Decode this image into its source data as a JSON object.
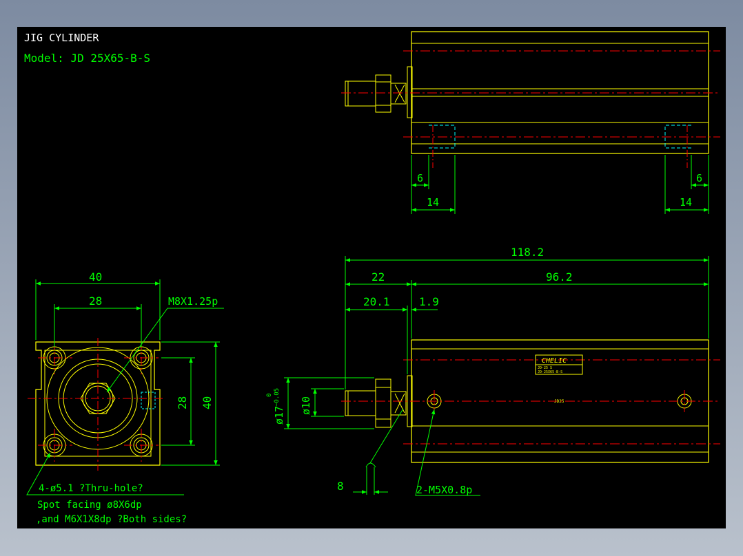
{
  "title": "JIG CYLINDER",
  "model": "Model: JD 25X65-B-S",
  "colors": {
    "background": "#000000",
    "outline": "#ffff00",
    "dimension": "#00ff00",
    "center_line": "#ff0000",
    "hidden_line": "#00ffff",
    "text": "#ffffff"
  },
  "dims": {
    "top_left_6": "6",
    "top_left_14": "14",
    "top_right_6": "6",
    "top_right_14": "14",
    "overall": "118.2",
    "rod_len": "22",
    "body_len": "96.2",
    "rod_20": "20.1",
    "rod_19": "1.9",
    "end_40w": "40",
    "end_28w": "28",
    "end_28h": "28",
    "end_40h": "40",
    "thread": "M8X1.25p",
    "dia17": "ø17",
    "dia17_tol_upper": "0",
    "dia17_tol_lower": "−0.05",
    "dia10": "ø10",
    "eight": "8",
    "ports": "2-M5X0.8p"
  },
  "notes": {
    "holes_line1": "4-ø5.1 ?Thru-hole?",
    "holes_line2": "Spot facing  ø8X6dp",
    "holes_line3": ",and M6X1X8dp ?Both sides?"
  },
  "label": {
    "brand": "CHELIC",
    "line1": "JD-25 S",
    "line2": "JD-25X65-B-S",
    "body_code": "JD25"
  }
}
